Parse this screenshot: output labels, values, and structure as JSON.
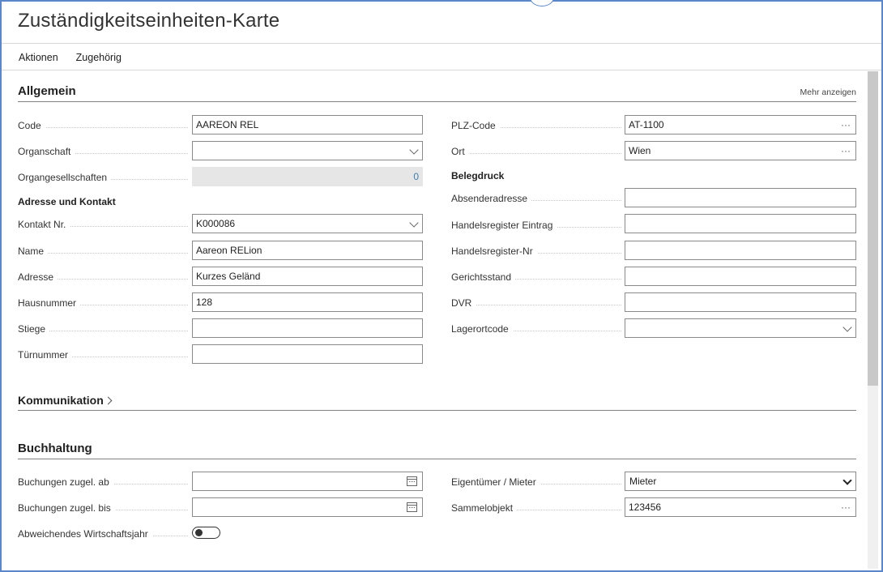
{
  "page": {
    "title": "Zuständigkeitseinheiten-Karte",
    "menu": [
      "Aktionen",
      "Zugehörig"
    ]
  },
  "allgemein": {
    "title": "Allgemein",
    "more_label": "Mehr anzeigen",
    "left": {
      "code": {
        "label": "Code",
        "value": "AAREON REL"
      },
      "organschaft": {
        "label": "Organschaft",
        "value": ""
      },
      "organgesellschaften": {
        "label": "Organgesellschaften",
        "value": "0"
      },
      "adresse_header": "Adresse und Kontakt",
      "kontakt_nr": {
        "label": "Kontakt Nr.",
        "value": "K000086"
      },
      "name": {
        "label": "Name",
        "value": "Aareon RELion"
      },
      "adresse": {
        "label": "Adresse",
        "value": "Kurzes Geländ"
      },
      "hausnummer": {
        "label": "Hausnummer",
        "value": "128"
      },
      "stiege": {
        "label": "Stiege",
        "value": ""
      },
      "tuernummer": {
        "label": "Türnummer",
        "value": ""
      }
    },
    "right": {
      "plz_code": {
        "label": "PLZ-Code",
        "value": "AT-1100",
        "suffix": "···"
      },
      "ort": {
        "label": "Ort",
        "value": "Wien",
        "suffix": "···"
      },
      "belegdruck_header": "Belegdruck",
      "absenderadresse": {
        "label": "Absenderadresse",
        "value": ""
      },
      "handelsregister_eintrag": {
        "label": "Handelsregister Eintrag",
        "value": ""
      },
      "handelsregister_nr": {
        "label": "Handelsregister-Nr",
        "value": ""
      },
      "gerichtsstand": {
        "label": "Gerichtsstand",
        "value": ""
      },
      "dvr": {
        "label": "DVR",
        "value": ""
      },
      "lagerortcode": {
        "label": "Lagerortcode",
        "value": ""
      }
    }
  },
  "kommunikation": {
    "title": "Kommunikation"
  },
  "buchhaltung": {
    "title": "Buchhaltung",
    "buchungen_ab": {
      "label": "Buchungen zugel. ab",
      "value": ""
    },
    "buchungen_bis": {
      "label": "Buchungen zugel. bis",
      "value": ""
    },
    "abweichendes_wj": {
      "label": "Abweichendes Wirtschaftsjahr",
      "on": false
    },
    "eigentuemer_mieter": {
      "label": "Eigentümer / Mieter",
      "value": "Mieter"
    },
    "sammelobjekt": {
      "label": "Sammelobjekt",
      "value": "123456",
      "suffix": "···"
    }
  },
  "colors": {
    "frame": "#5b86c9",
    "readonly_bg": "#e6e6e6",
    "readonly_text": "#3e7fb0"
  }
}
